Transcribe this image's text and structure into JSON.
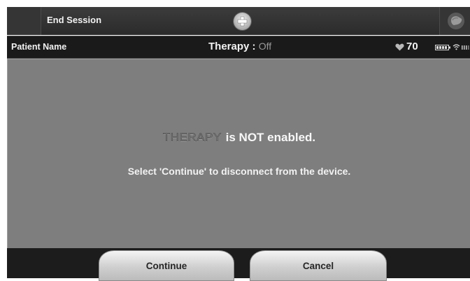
{
  "header": {
    "end_session_label": "End Session",
    "plus_icon": "plus-circle-icon",
    "device_icon": "device-icon"
  },
  "status": {
    "patient_label": "Patient Name",
    "therapy_label": "Therapy :",
    "therapy_value": "Off",
    "heart_rate": "70",
    "heart_icon": "heart-icon",
    "battery_icon": "battery-icon",
    "wifi_icon": "wifi-icon",
    "signal_icon": "signal-icon"
  },
  "message": {
    "therapy_word": "THERAPY",
    "headline_rest": "is NOT enabled.",
    "subtext": "Select 'Continue' to disconnect from the device."
  },
  "actions": {
    "continue_label": "Continue",
    "cancel_label": "Cancel"
  },
  "colors": {
    "panel": "#7e7e7e",
    "bar_dark": "#1a1a1a",
    "button_light": "#e2e2e2"
  }
}
